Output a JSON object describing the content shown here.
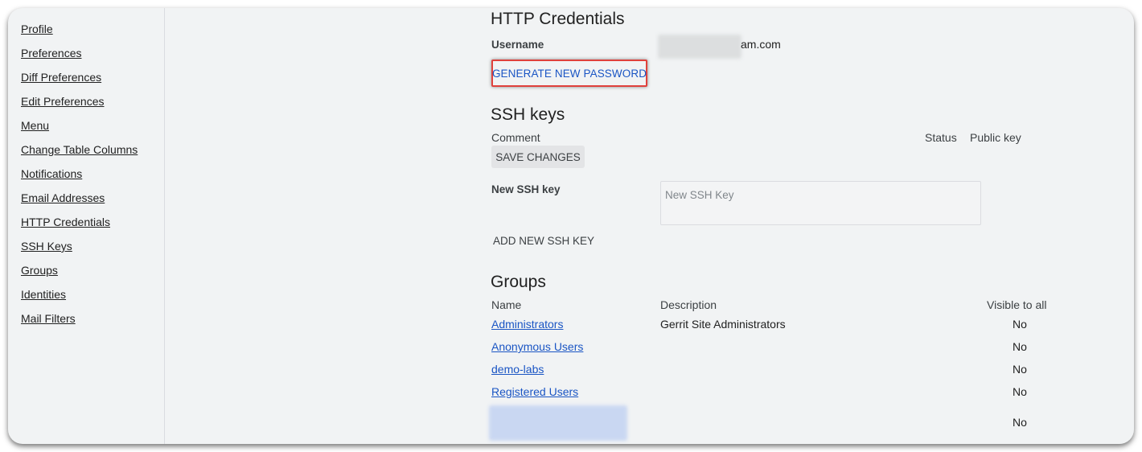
{
  "sidebar": {
    "items": [
      {
        "label": "Profile"
      },
      {
        "label": "Preferences"
      },
      {
        "label": "Diff Preferences"
      },
      {
        "label": "Edit Preferences"
      },
      {
        "label": "Menu"
      },
      {
        "label": "Change Table Columns"
      },
      {
        "label": "Notifications"
      },
      {
        "label": "Email Addresses"
      },
      {
        "label": "HTTP Credentials"
      },
      {
        "label": "SSH Keys"
      },
      {
        "label": "Groups"
      },
      {
        "label": "Identities"
      },
      {
        "label": "Mail Filters"
      }
    ]
  },
  "http_credentials": {
    "title": "HTTP Credentials",
    "username_label": "Username",
    "username_visible_suffix": "am.com",
    "generate_button": "GENERATE NEW PASSWORD"
  },
  "ssh_keys": {
    "title": "SSH keys",
    "columns": {
      "comment": "Comment",
      "status": "Status",
      "public_key": "Public key"
    },
    "save_button": "SAVE CHANGES",
    "new_key_label": "New SSH key",
    "new_key_placeholder": "New SSH Key",
    "add_button": "ADD NEW SSH KEY"
  },
  "groups": {
    "title": "Groups",
    "columns": {
      "name": "Name",
      "description": "Description",
      "visible": "Visible to all"
    },
    "rows": [
      {
        "name": "Administrators",
        "description": "Gerrit Site Administrators",
        "visible": "No"
      },
      {
        "name": "Anonymous Users",
        "description": "",
        "visible": "No"
      },
      {
        "name": "demo-labs",
        "description": "",
        "visible": "No"
      },
      {
        "name": "Registered Users",
        "description": "",
        "visible": "No"
      },
      {
        "name": "",
        "description": "",
        "visible": "No"
      }
    ]
  },
  "colors": {
    "background": "#f1f3f4",
    "link": "#1a55c4",
    "highlight_border": "#e0413c"
  }
}
